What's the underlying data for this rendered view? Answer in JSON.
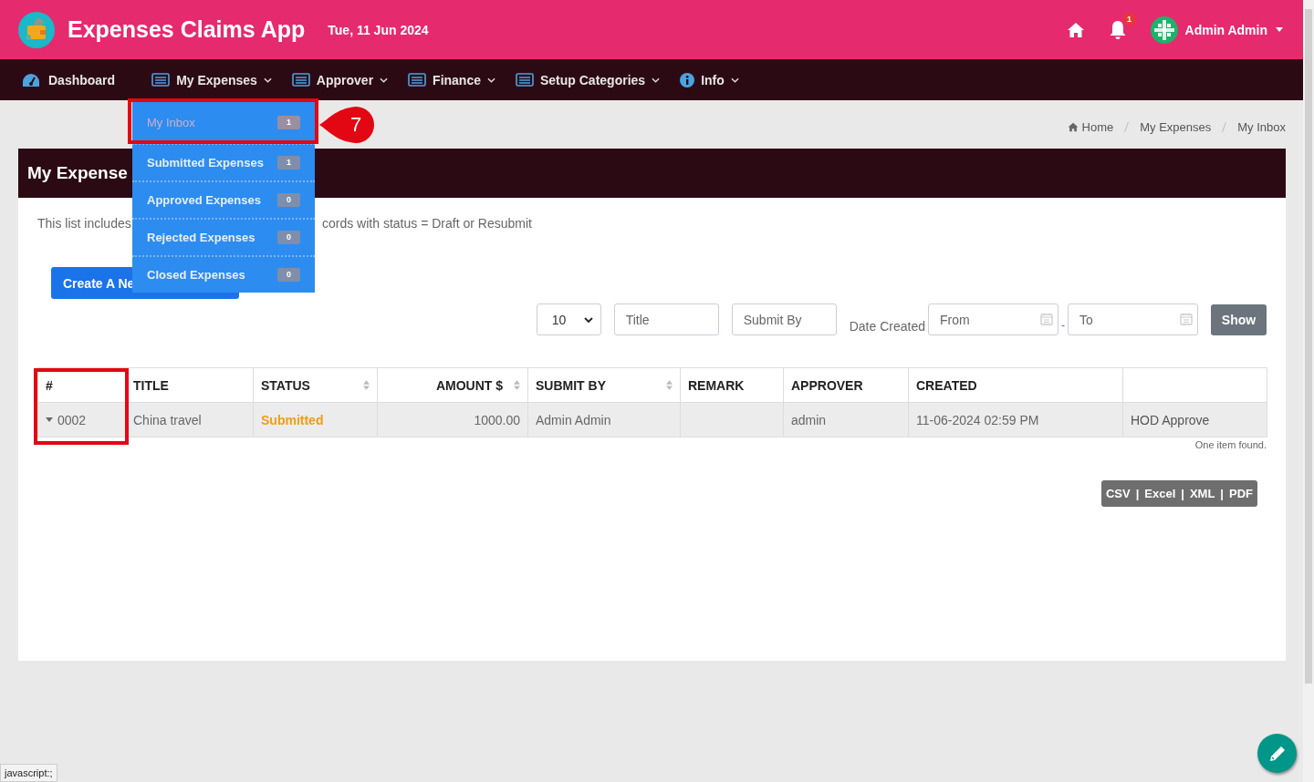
{
  "header": {
    "app_title": "Expenses Claims App",
    "date": "Tue, 11 Jun 2024",
    "notification_count": "1",
    "user": "Admin Admin"
  },
  "nav": [
    {
      "label": "Dashboard",
      "kind": "gauge",
      "dropdown": false
    },
    {
      "label": "My Expenses",
      "kind": "list",
      "dropdown": true
    },
    {
      "label": "Approver",
      "kind": "list",
      "dropdown": true
    },
    {
      "label": "Finance",
      "kind": "list",
      "dropdown": true
    },
    {
      "label": "Setup Categories",
      "kind": "list",
      "dropdown": true
    },
    {
      "label": "Info",
      "kind": "info",
      "dropdown": true
    }
  ],
  "dropdown": [
    {
      "label": "My Inbox",
      "count": "1",
      "selected": true
    },
    {
      "label": "Submitted Expenses",
      "count": "1",
      "selected": false
    },
    {
      "label": "Approved Expenses",
      "count": "0",
      "selected": false
    },
    {
      "label": "Rejected Expenses",
      "count": "0",
      "selected": false
    },
    {
      "label": "Closed Expenses",
      "count": "0",
      "selected": false
    }
  ],
  "callout": {
    "number": "7"
  },
  "breadcrumb": [
    "Home",
    "My Expenses",
    "My Inbox"
  ],
  "card": {
    "title": "My Expense",
    "note_start": "This list includes",
    "note_end": "cords with status = Draft or Resubmit",
    "create_button": "Create A Ne"
  },
  "filters": {
    "page_size": "10",
    "title_placeholder": "Title",
    "submit_by_placeholder": "Submit By",
    "date_label": "Date Created",
    "from_placeholder": "From",
    "separator": "-",
    "to_placeholder": "To",
    "show_button": "Show"
  },
  "table": {
    "columns": [
      {
        "label": "#",
        "sortable": false
      },
      {
        "label": "TITLE",
        "sortable": false
      },
      {
        "label": "STATUS",
        "sortable": true
      },
      {
        "label": "AMOUNT $",
        "sortable": true
      },
      {
        "label": "SUBMIT BY",
        "sortable": true
      },
      {
        "label": "REMARK",
        "sortable": false
      },
      {
        "label": "APPROVER",
        "sortable": false
      },
      {
        "label": "CREATED",
        "sortable": false
      },
      {
        "sortable": false
      }
    ],
    "rows": [
      {
        "expanded": false,
        "id": "0002",
        "title": "China travel",
        "status": "Submitted",
        "amount": "1000.00",
        "submit_by": "Admin Admin",
        "approver": "admin",
        "created": "11-06-2024 02:59 PM",
        "action": "HOD Approve"
      }
    ]
  },
  "summary": "One item found.",
  "exports": {
    "items": [
      "CSV",
      "Excel",
      "XML",
      "PDF"
    ],
    "separator": "|"
  },
  "status_tooltip": "javascript:;"
}
